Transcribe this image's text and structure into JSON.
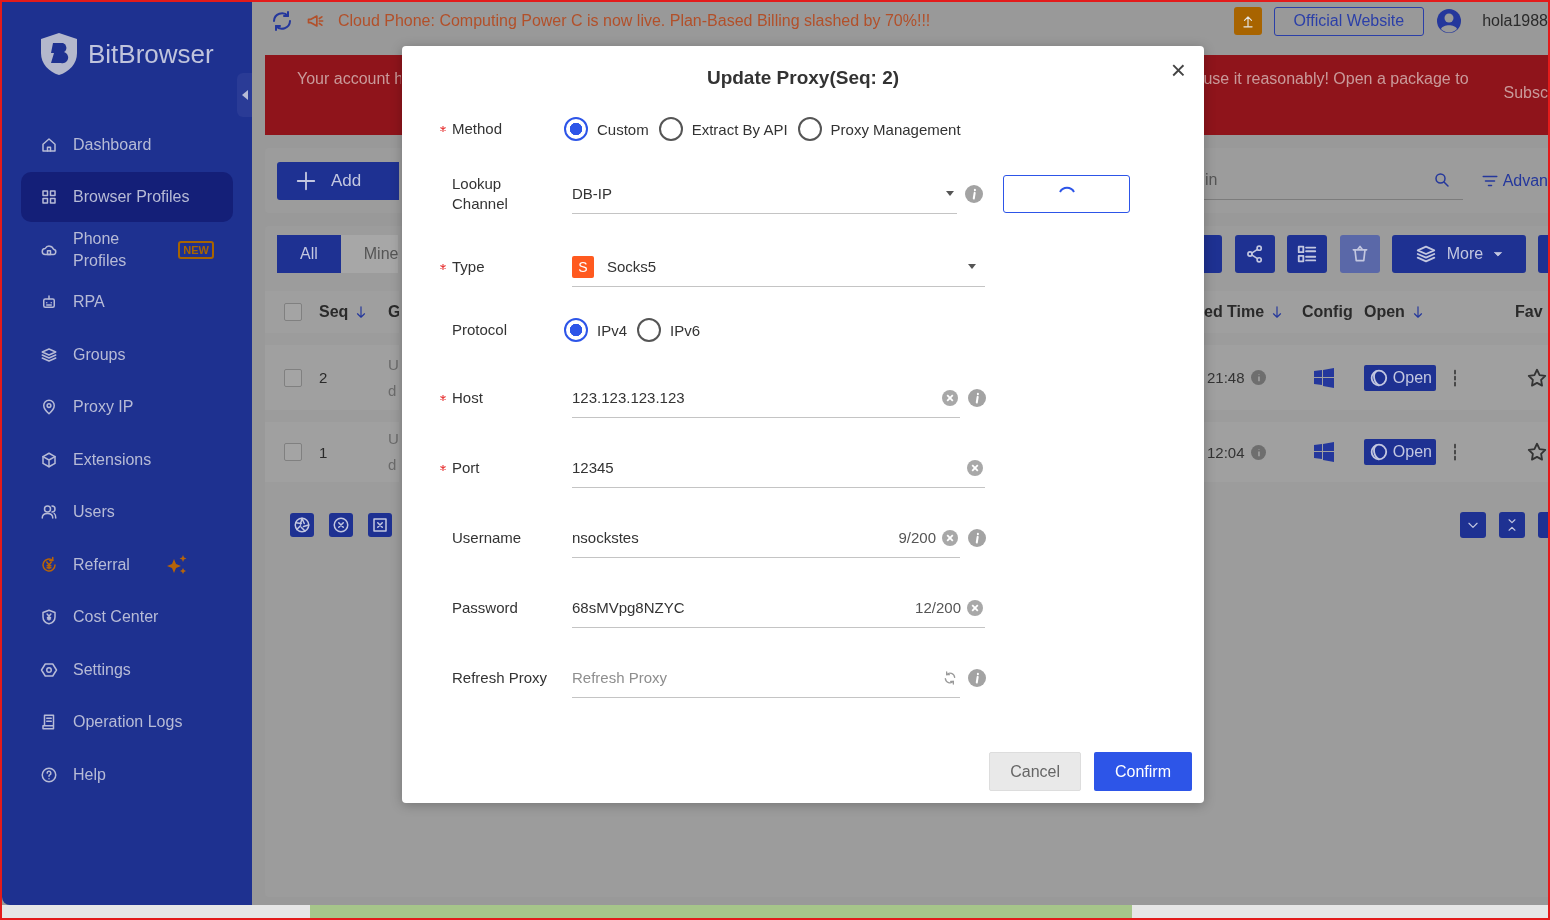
{
  "announcement": {
    "text": "Cloud Phone: Computing Power C is now live. Plan-Based Billing slashed by 70%!!!"
  },
  "header": {
    "website_button": "Official Website",
    "username": "hola1988"
  },
  "sidebar": {
    "brand": "BitBrowser",
    "items": [
      {
        "label": "Dashboard",
        "selected": false,
        "kind": "normal"
      },
      {
        "label": "Browser Profiles",
        "selected": true,
        "kind": "normal"
      },
      {
        "label": "Phone Profiles",
        "selected": false,
        "kind": "normal",
        "badge": "NEW"
      },
      {
        "label": "RPA",
        "selected": false,
        "kind": "normal"
      },
      {
        "label": "Groups",
        "selected": false,
        "kind": "normal"
      },
      {
        "label": "Proxy IP",
        "selected": false,
        "kind": "normal"
      },
      {
        "label": "Extensions",
        "selected": false,
        "kind": "normal"
      },
      {
        "label": "Users",
        "selected": false,
        "kind": "normal"
      },
      {
        "label": "Referral",
        "selected": false,
        "kind": "promo"
      },
      {
        "label": "Cost Center",
        "selected": false,
        "kind": "normal"
      },
      {
        "label": "Settings",
        "selected": false,
        "kind": "normal"
      },
      {
        "label": "Operation Logs",
        "selected": false,
        "kind": "normal"
      },
      {
        "label": "Help",
        "selected": false,
        "kind": "normal"
      }
    ]
  },
  "banner": {
    "text_start": "Your account h",
    "text_end": "use it reasonably! Open a package to",
    "text_far": "Subsc"
  },
  "toolbar": {
    "add_button": "Add",
    "search_value": "in",
    "advanced_filter": "Advan"
  },
  "profile_tabs": [
    {
      "label": "All",
      "selected": true
    },
    {
      "label": "Mine",
      "selected": false
    }
  ],
  "more_button": "More",
  "table": {
    "all_checked": false,
    "columns": [
      {
        "label": "Seq",
        "sorted": true
      },
      {
        "label": "G",
        "sorted": false
      },
      {
        "label": "ed Time",
        "sorted": true
      },
      {
        "label": "Config",
        "sorted": false
      },
      {
        "label": "Open",
        "sorted": true
      },
      {
        "label": "Fav",
        "sorted": false
      }
    ],
    "rows": [
      {
        "checked": false,
        "seq": "2",
        "column_3": [
          "U",
          "d"
        ],
        "time": "21:48",
        "open_button": "Open",
        "favorite": false
      },
      {
        "checked": false,
        "seq": "1",
        "column_3": [
          "U",
          "d"
        ],
        "time": "12:04",
        "open_button": "Open",
        "favorite": false
      }
    ]
  },
  "dialog": {
    "title": "Update Proxy(Seq: 2)",
    "close": "×",
    "fields": [
      {
        "kind": "radio",
        "label": "Method",
        "required": true,
        "options": [
          {
            "label": "Custom",
            "selected": true
          },
          {
            "label": "Extract By API",
            "selected": false
          },
          {
            "label": "Proxy Management",
            "selected": false
          }
        ]
      },
      {
        "kind": "select",
        "label": "Lookup Channel",
        "required": false,
        "value": "DB-IP",
        "info": true,
        "loading": true
      },
      {
        "kind": "select",
        "label": "Type",
        "required": true,
        "value": "Socks5",
        "badge": "S",
        "info": false
      },
      {
        "kind": "radio",
        "label": "Protocol",
        "required": false,
        "options": [
          {
            "label": "IPv4",
            "selected": true
          },
          {
            "label": "IPv6",
            "selected": false
          }
        ]
      },
      {
        "kind": "input",
        "label": "Host",
        "required": true,
        "value": "123.123.123.123",
        "clearable": true,
        "info": true
      },
      {
        "kind": "input",
        "label": "Port",
        "required": true,
        "value": "12345",
        "clearable": true,
        "info": false
      },
      {
        "kind": "input",
        "label": "Username",
        "required": false,
        "value": "nsockstes",
        "count": "9/200",
        "clearable": true,
        "info": true
      },
      {
        "kind": "input",
        "label": "Password",
        "required": false,
        "value": "68sMVpg8NZYC",
        "count": "12/200",
        "clearable": true,
        "info": false
      },
      {
        "kind": "input",
        "label": "Refresh Proxy",
        "required": false,
        "placeholder": "Refresh Proxy",
        "refreshable": true,
        "clearable": false,
        "info": true
      }
    ],
    "buttons": [
      {
        "label": "Cancel",
        "kind": "secondary"
      },
      {
        "label": "Confirm",
        "kind": "primary"
      }
    ]
  }
}
